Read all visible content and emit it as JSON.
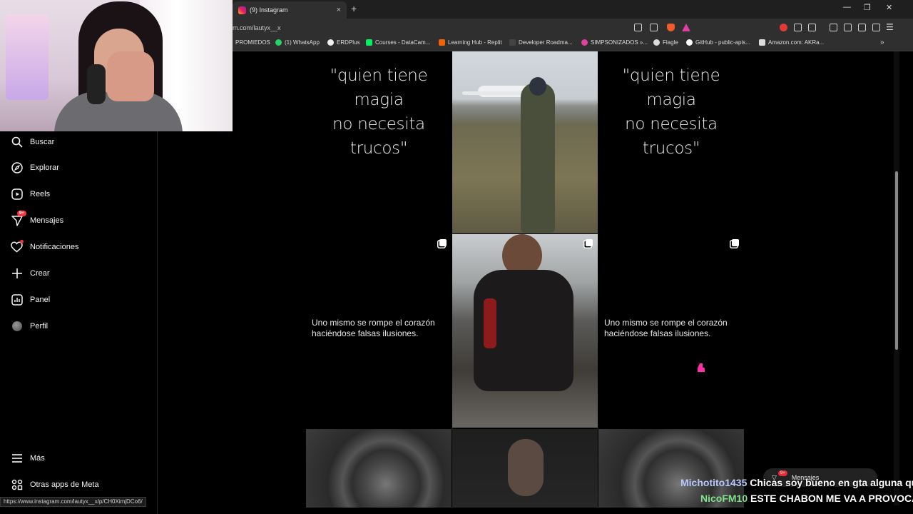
{
  "browser": {
    "tab_title": "(9) Instagram",
    "tab_close": "×",
    "new_tab": "+",
    "url": "m.com/lautyx__x",
    "win_minimize": "—",
    "win_restore": "❐",
    "win_close": "✕",
    "bookmarks": [
      {
        "label": "PROMIEDOS",
        "color": "#2e7d32"
      },
      {
        "label": "(1) WhatsApp",
        "color": "#25d366"
      },
      {
        "label": "ERDPlus",
        "color": "#f0f0f0"
      },
      {
        "label": "Courses - DataCam...",
        "color": "#03ef62"
      },
      {
        "label": "Learning Hub - Replit",
        "color": "#f26207"
      },
      {
        "label": "Developer Roadma...",
        "color": "#222222"
      },
      {
        "label": "SIMPSONIZADOS »...",
        "color": "#e040a0"
      },
      {
        "label": "Flagle",
        "color": "#dddddd"
      },
      {
        "label": "GitHub - public-apis...",
        "color": "#ffffff"
      },
      {
        "label": "Amazon.com: AKRa...",
        "color": "#dddddd"
      }
    ],
    "bookmarks_more": "»"
  },
  "sidebar": {
    "items": [
      {
        "label": "Buscar",
        "icon": "search-icon"
      },
      {
        "label": "Explorar",
        "icon": "compass-icon"
      },
      {
        "label": "Reels",
        "icon": "reels-icon"
      },
      {
        "label": "Mensajes",
        "icon": "messenger-icon",
        "badge": "9+"
      },
      {
        "label": "Notificaciones",
        "icon": "heart-icon"
      },
      {
        "label": "Crear",
        "icon": "plus-icon"
      },
      {
        "label": "Panel",
        "icon": "dashboard-icon"
      },
      {
        "label": "Perfil",
        "icon": "avatar"
      }
    ],
    "more_label": "Más",
    "meta_label": "Otras apps de Meta"
  },
  "grid": {
    "quote_big_line1": "\"quien tiene magia",
    "quote_big_line2": "no necesita",
    "quote_big_line3": "trucos\"",
    "quote_small_line1": "Uno mismo se rompe el corazón",
    "quote_small_line2": "haciéndose falsas ilusiones."
  },
  "status_url": "https://www.instagram.com/lautyx__x/p/CH0XimjDCo6/",
  "messages_pill": {
    "label": "Mensajes",
    "badge": "9+"
  },
  "chat": [
    {
      "user": "Michotito1435",
      "message": "Chicas soy bueno en gta alguna qu"
    },
    {
      "user": "NicoFM10",
      "message": "ESTE CHABON ME VA A PROVOCA"
    }
  ]
}
